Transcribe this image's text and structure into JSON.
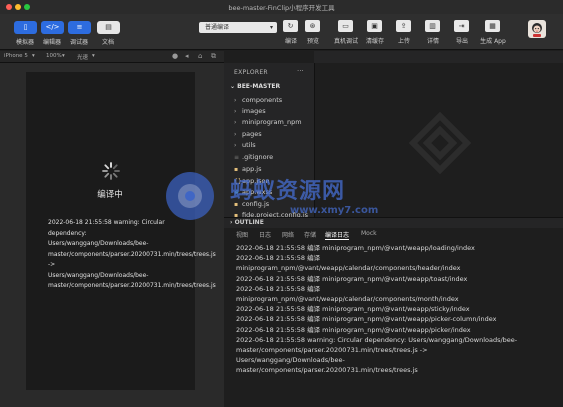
{
  "window": {
    "title": "bee-master-FinClip小程序开发工具"
  },
  "toolbar": {
    "left_buttons": [
      {
        "label": "模拟器",
        "icon": "phone-icon"
      },
      {
        "label": "编辑器",
        "icon": "code-icon"
      },
      {
        "label": "调试器",
        "icon": "debug-icon"
      },
      {
        "label": "文档",
        "icon": "doc-icon"
      }
    ],
    "compile_mode": "普通编译",
    "right_buttons": [
      {
        "label": "编译",
        "icon": "refresh-icon"
      },
      {
        "label": "预览",
        "icon": "preview-icon"
      },
      {
        "label": "真机调试",
        "icon": "device-icon"
      },
      {
        "label": "清缓存",
        "icon": "clear-icon"
      },
      {
        "label": "上传",
        "icon": "upload-icon"
      },
      {
        "label": "详情",
        "icon": "detail-icon"
      },
      {
        "label": "导出",
        "icon": "export-icon"
      },
      {
        "label": "生成 App",
        "icon": "app-icon"
      }
    ]
  },
  "simulator": {
    "device": "iPhone 5",
    "zoom": "100%",
    "network": "光速",
    "status": "编译中",
    "log": "2022-06-18 21:55:58 warning: Circular dependency:\nUsers/wanggang/Downloads/bee-master/components/parser.20200731.min/trees/trees.js ->\nUsers/wanggang/Downloads/bee-master/components/parser.20200731.min/trees/trees.js"
  },
  "explorer": {
    "title": "EXPLORER",
    "more": "···",
    "project": "BEE-MASTER",
    "items": [
      {
        "name": "components",
        "type": "folder"
      },
      {
        "name": "images",
        "type": "folder"
      },
      {
        "name": "miniprogram_npm",
        "type": "folder"
      },
      {
        "name": "pages",
        "type": "folder"
      },
      {
        "name": "utils",
        "type": "folder"
      },
      {
        "name": ".gitignore",
        "type": "file"
      },
      {
        "name": "app.js",
        "type": "js"
      },
      {
        "name": "app.json",
        "type": "json"
      },
      {
        "name": "app.wxss",
        "type": "wxss"
      },
      {
        "name": "config.js",
        "type": "js"
      },
      {
        "name": "fide.project.config.js",
        "type": "js"
      }
    ]
  },
  "outline": {
    "label": "OUTLINE"
  },
  "console": {
    "tabs": [
      "视图",
      "日志",
      "网络",
      "存储",
      "编译日志",
      "Mock"
    ],
    "active_tab": "编译日志",
    "log": "2022-06-18 21:55:58 编译 miniprogram_npm/@vant/weapp/loading/index\n2022-06-18 21:55:58 编译\nminiprogram_npm/@vant/weapp/calendar/components/header/index\n2022-06-18 21:55:58 编译 miniprogram_npm/@vant/weapp/toast/index\n2022-06-18 21:55:58 编译\nminiprogram_npm/@vant/weapp/calendar/components/month/index\n2022-06-18 21:55:58 编译 miniprogram_npm/@vant/weapp/sticky/index\n2022-06-18 21:55:58 编译 miniprogram_npm/@vant/weapp/picker-column/index\n2022-06-18 21:55:58 编译 miniprogram_npm/@vant/weapp/picker/index\n2022-06-18 21:55:58 warning: Circular dependency: Users/wanggang/Downloads/bee-\nmaster/components/parser.20200731.min/trees/trees.js ->\nUsers/wanggang/Downloads/bee-\nmaster/components/parser.20200731.min/trees/trees.js"
  },
  "watermark": {
    "text": "蚂蚁资源网",
    "url": "www.xmy7.com"
  },
  "colors": {
    "accent": "#2d6cdf",
    "background": "#1e1e1e",
    "panel": "#252526",
    "toolbar": "#2f2f2f"
  }
}
